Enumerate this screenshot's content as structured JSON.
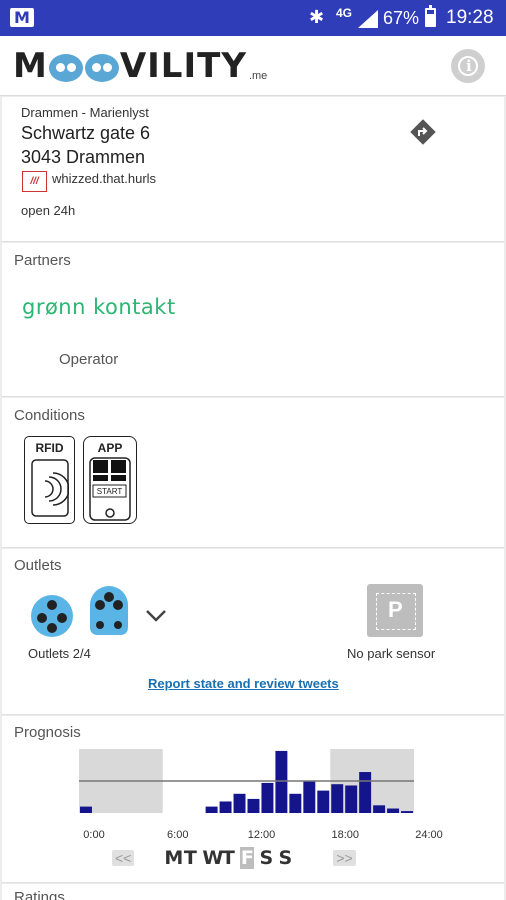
{
  "status_bar": {
    "network": "4G",
    "battery": "67%",
    "time": "19:28"
  },
  "header": {
    "logo": {
      "brand_before": "M",
      "brand_after": "VILITY",
      "suffix": ".me"
    },
    "info_icon": "info-icon"
  },
  "location": {
    "area": "Drammen - Marienlyst",
    "street": "Schwartz gate 6",
    "postal_city": "3043 Drammen",
    "user_badge": "///",
    "user_name": "whizzed.that.hurls",
    "hours": "open 24h",
    "directions_icon": "directions-icon"
  },
  "partners": {
    "title": "Partners",
    "logo_text": "grønn kontakt",
    "role": "Operator"
  },
  "conditions": {
    "title": "Conditions",
    "items": [
      {
        "label": "RFID",
        "icon": "rfid-card-icon"
      },
      {
        "label": "APP",
        "icon": "phone-app-icon",
        "sub_label": "START"
      }
    ]
  },
  "outlets": {
    "title": "Outlets",
    "summary": "Outlets 2/4",
    "park_sensor": "No park sensor",
    "park_letter": "P",
    "report_link": "Report state and review tweets",
    "colors": {
      "outlet": "#5ab4e6",
      "park": "#bdbdbd"
    }
  },
  "prognosis": {
    "title": "Prognosis",
    "prev_label": "<<",
    "next_label": ">>",
    "days": [
      {
        "label": "M",
        "active": false
      },
      {
        "label": "T",
        "active": false
      },
      {
        "label": "W",
        "active": false
      },
      {
        "label": "T",
        "active": false
      },
      {
        "label": "F",
        "active": true
      },
      {
        "label": "S",
        "active": false
      },
      {
        "label": "S",
        "active": false
      }
    ]
  },
  "chart_data": {
    "type": "bar",
    "x_ticks": [
      "0:00",
      "6:00",
      "12:00",
      "18:00",
      "24:00"
    ],
    "xlim": [
      0,
      24
    ],
    "ylim": [
      0,
      1
    ],
    "bar_color": "#14148c",
    "night_shading": [
      [
        0,
        6
      ],
      [
        18,
        24
      ]
    ],
    "reference_level": 0.5,
    "hourly": [
      {
        "hour": 0,
        "value": 0.1
      },
      {
        "hour": 9,
        "value": 0.1
      },
      {
        "hour": 10,
        "value": 0.18
      },
      {
        "hour": 11,
        "value": 0.3
      },
      {
        "hour": 12,
        "value": 0.22
      },
      {
        "hour": 13,
        "value": 0.47
      },
      {
        "hour": 14,
        "value": 0.97
      },
      {
        "hour": 15,
        "value": 0.3
      },
      {
        "hour": 16,
        "value": 0.5
      },
      {
        "hour": 17,
        "value": 0.35
      },
      {
        "hour": 18,
        "value": 0.45
      },
      {
        "hour": 19,
        "value": 0.43
      },
      {
        "hour": 20,
        "value": 0.64
      },
      {
        "hour": 21,
        "value": 0.12
      },
      {
        "hour": 22,
        "value": 0.07
      },
      {
        "hour": 23,
        "value": 0.03
      }
    ]
  },
  "ratings": {
    "title": "Ratings"
  }
}
